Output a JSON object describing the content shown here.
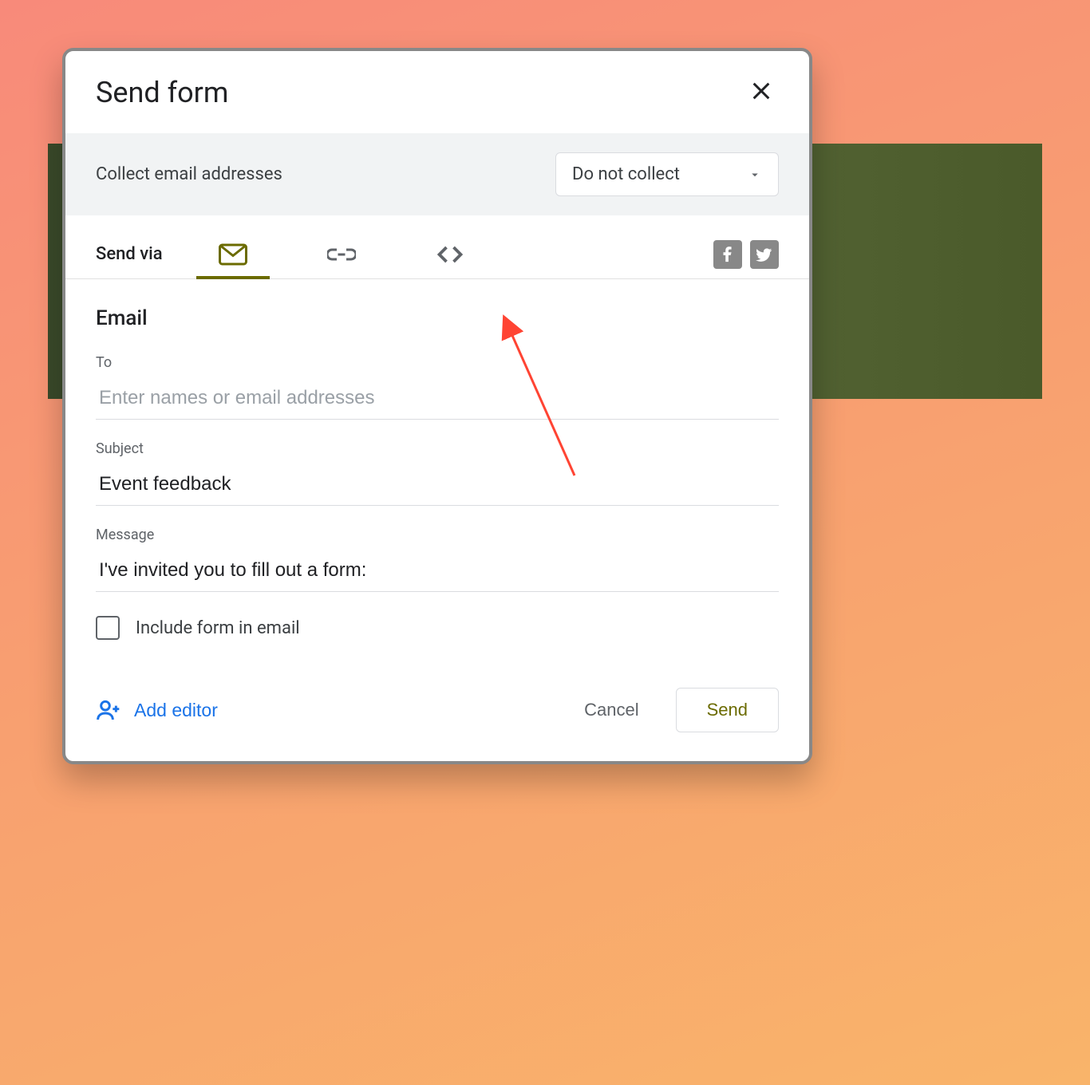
{
  "dialog": {
    "title": "Send form",
    "close_aria": "Close"
  },
  "collect": {
    "label": "Collect email addresses",
    "selected": "Do not collect"
  },
  "sendvia": {
    "label": "Send via"
  },
  "email": {
    "heading": "Email",
    "to_label": "To",
    "to_placeholder": "Enter names or email addresses",
    "to_value": "",
    "subject_label": "Subject",
    "subject_value": "Event feedback",
    "message_label": "Message",
    "message_value": "I've invited you to fill out a form:",
    "include_label": "Include form in email",
    "include_checked": false
  },
  "footer": {
    "add_editor": "Add editor",
    "cancel": "Cancel",
    "send": "Send"
  }
}
